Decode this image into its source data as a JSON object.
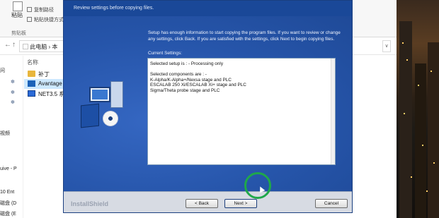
{
  "explorer": {
    "ribbon": {
      "paste_label": "粘贴",
      "copy_path_label": "复制路径",
      "paste_shortcut_label": "粘贴快捷方式",
      "clipboard_group": "剪贴板"
    },
    "address": {
      "path_root": "此电脑",
      "path_next": "本"
    },
    "nav_pane": [
      "问",
      "视频",
      "uive - P",
      "10 Ent",
      "磁盘 (D",
      "磁盘 (E"
    ],
    "file_list": {
      "column_name": "名称",
      "items": [
        {
          "label": "补丁",
          "icon": "folder-icon"
        },
        {
          "label": "Avantage",
          "icon": "app-icon"
        },
        {
          "label": "NET3.5 系",
          "icon": "net-icon"
        }
      ]
    }
  },
  "installer": {
    "subtitle": "Review settings before copying files.",
    "intro_text": "Setup has enough information to start copying the program files.  If you want to review or change any settings, click Back.  If you are satisfied with the settings, click Next to begin copying files.",
    "current_settings_label": "Current Settings:",
    "settings_lines": [
      "Selected setup is :  -    Processing only",
      "",
      "Selected components are : -",
      "K-Alpha/K-Alpha+/Nexsa stage and PLC",
      "ESCALAB 250 Xi/ESCALAB Xi+ stage and PLC",
      "Sigma/Theta probe stage and PLC"
    ],
    "brand": "InstallShield",
    "buttons": {
      "back": "< Back",
      "next": "Next >",
      "cancel": "Cancel"
    }
  },
  "colors": {
    "dialog_blue": "#2252a8",
    "highlight_ring": "#1fa84a"
  }
}
